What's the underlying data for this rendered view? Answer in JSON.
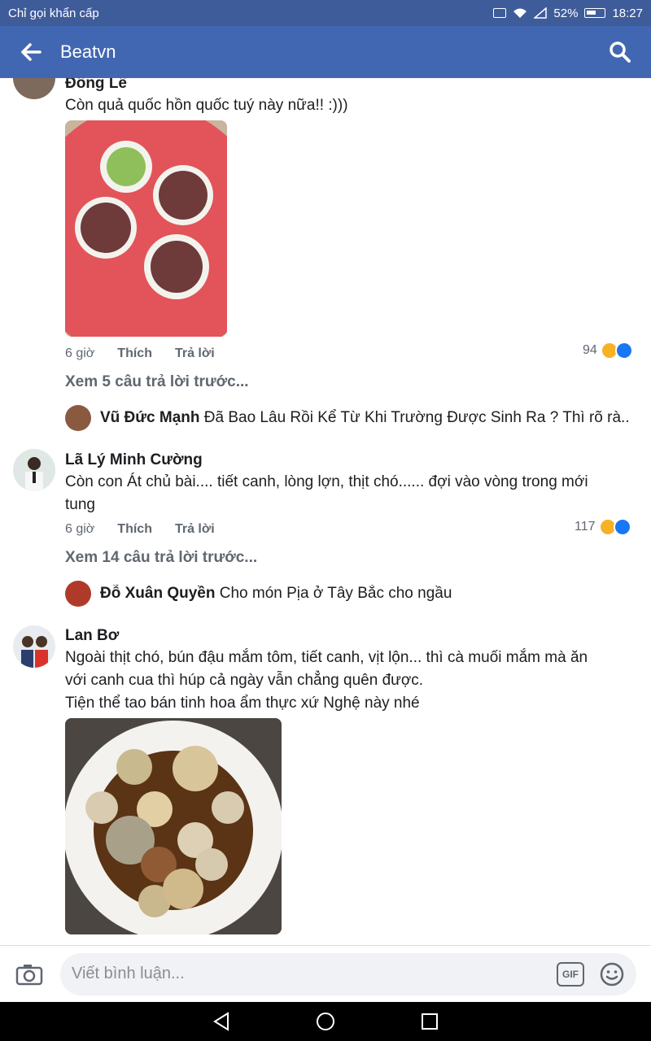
{
  "status_bar": {
    "carrier": "Chỉ gọi khẩn cấp",
    "battery": "52%",
    "time": "18:27"
  },
  "app_bar": {
    "title": "Beatvn"
  },
  "comments": [
    {
      "author": "Đông Lê",
      "text": "Còn quả quốc hồn quốc tuý này nữa!! :)))",
      "time": "6 giờ",
      "like_label": "Thích",
      "reply_label": "Trả lời",
      "reactions": "94",
      "more_replies": "Xem 5 câu trả lời trước...",
      "reply": {
        "author": "Vũ Đức Mạnh",
        "text": "Đã Bao Lâu Rồi Kể Từ Khi Trường Được Sinh Ra ? Thì rõ rà..."
      }
    },
    {
      "author": "Lã Lý Minh Cường",
      "text_line1": "Còn con Át chủ bài.... tiết canh, lòng lợn, thịt chó...... đợi vào vòng trong mới",
      "text_line2": "tung",
      "time": "6 giờ",
      "like_label": "Thích",
      "reply_label": "Trả lời",
      "reactions": "117",
      "more_replies": "Xem 14 câu trả lời trước...",
      "reply": {
        "author": "Đỗ Xuân Quyền",
        "text": "Cho món Pịa ở Tây Bắc cho ngầu"
      }
    },
    {
      "author": "Lan Bơ",
      "text_line1": "Ngoài thịt chó, bún đậu mắm tôm, tiết canh, vịt lộn... thì cà muối mắm mà ăn",
      "text_line2": "với canh cua thì húp cả ngày vẫn chẳng quên được.",
      "text_line3": "Tiện thể tao bán tinh hoa ẩm thực xứ Nghệ này nhé"
    }
  ],
  "composer": {
    "placeholder": "Viết bình luận...",
    "gif_label": "GIF"
  },
  "colors": {
    "header": "#4267b2",
    "status": "#3f5c9a"
  }
}
